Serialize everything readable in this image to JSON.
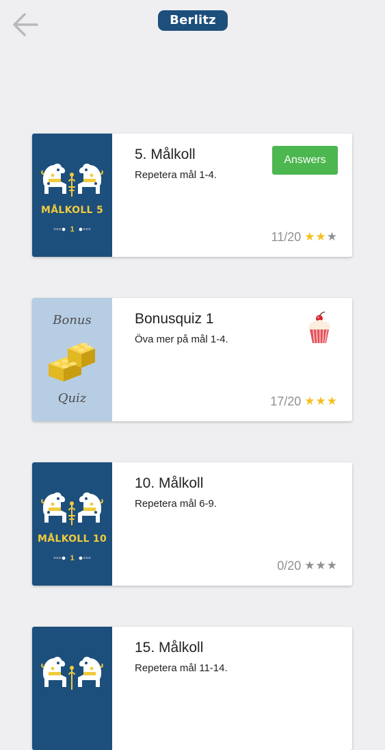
{
  "header": {
    "back_icon": "arrow-left-icon",
    "logo_text": "Berlitz"
  },
  "colors": {
    "background": "#efeff1",
    "brand_blue": "#1d4f7c",
    "answers_green": "#4cb64f",
    "star_gold": "#f4c01e",
    "star_gray": "#8f9093",
    "bonus_bg": "#b7cde3"
  },
  "cards": [
    {
      "title": "5. Målkoll",
      "subtitle": "Repetera mål 1-4.",
      "thumb_label": "MÅLKOLL 5",
      "thumb_ornament_num": "1",
      "answers_label": "Answers",
      "score": "11/20",
      "stars_earned": 2,
      "stars_total": 3
    },
    {
      "title": "Bonusquiz 1",
      "subtitle": "Öva mer på mål 1-4.",
      "thumb_top": "Bonus",
      "thumb_bottom": "Quiz",
      "badge_icon": "cupcake-icon",
      "score": "17/20",
      "stars_earned": 3,
      "stars_total": 3
    },
    {
      "title": "10. Målkoll",
      "subtitle": "Repetera mål 6-9.",
      "thumb_label": "MÅLKOLL 10",
      "thumb_ornament_num": "1",
      "score": "0/20",
      "stars_earned": 0,
      "stars_total": 3
    },
    {
      "title": "15. Målkoll",
      "subtitle": "Repetera mål 11-14."
    }
  ]
}
